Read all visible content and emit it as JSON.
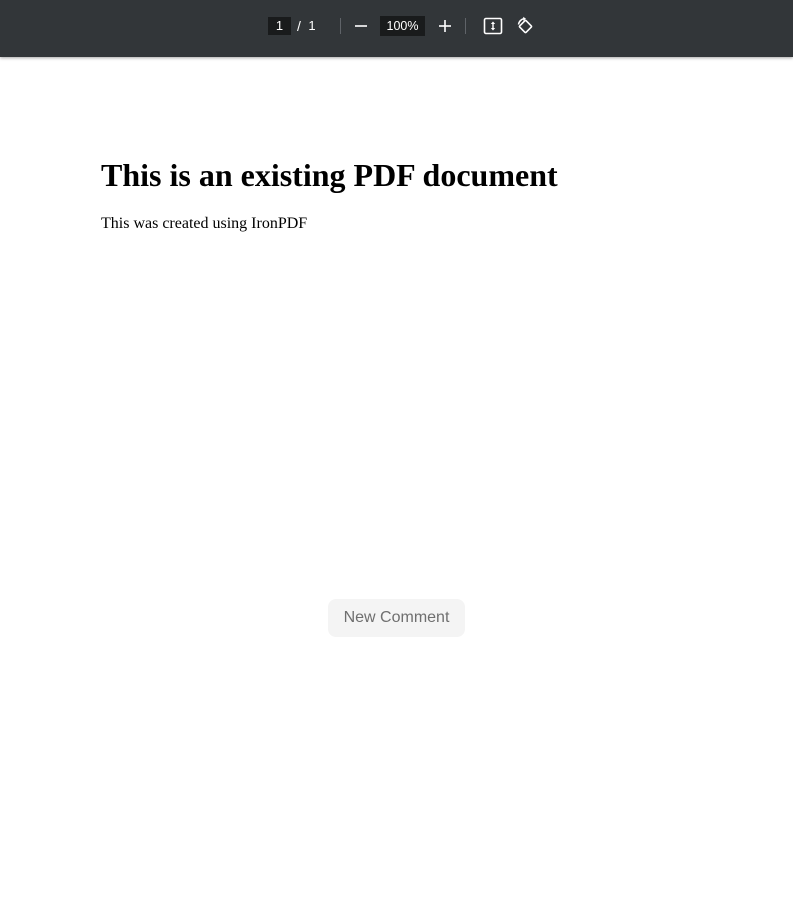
{
  "toolbar": {
    "current_page": "1",
    "page_separator": "/",
    "total_pages": "1",
    "zoom_level": "100%",
    "icons": {
      "zoom_out": "minus-icon",
      "zoom_in": "plus-icon",
      "fit_page": "fit-to-page-icon",
      "rotate": "rotate-counterclockwise-icon"
    },
    "background_color": "#323639",
    "icon_color": "#ffffff"
  },
  "document": {
    "heading": "This is an existing PDF document",
    "paragraph": "This was created using IronPDF"
  },
  "new_comment_label": "New Comment"
}
